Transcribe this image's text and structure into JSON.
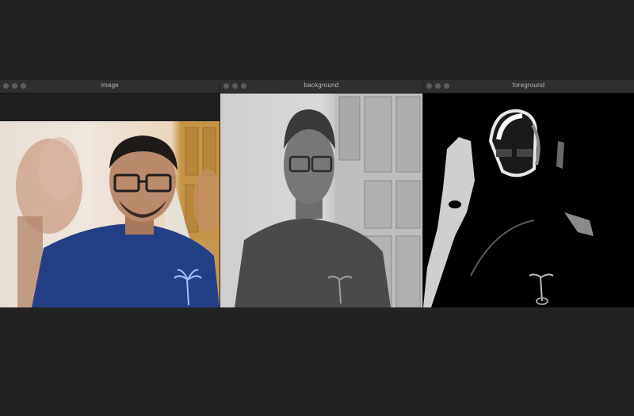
{
  "windows": [
    {
      "title": "image"
    },
    {
      "title": "background"
    },
    {
      "title": "foreground"
    }
  ],
  "colors": {
    "desktop": "#222224",
    "titlebar": "#2f2f31",
    "shirt_blue": "#233f86",
    "skin": "#b98a6c"
  }
}
